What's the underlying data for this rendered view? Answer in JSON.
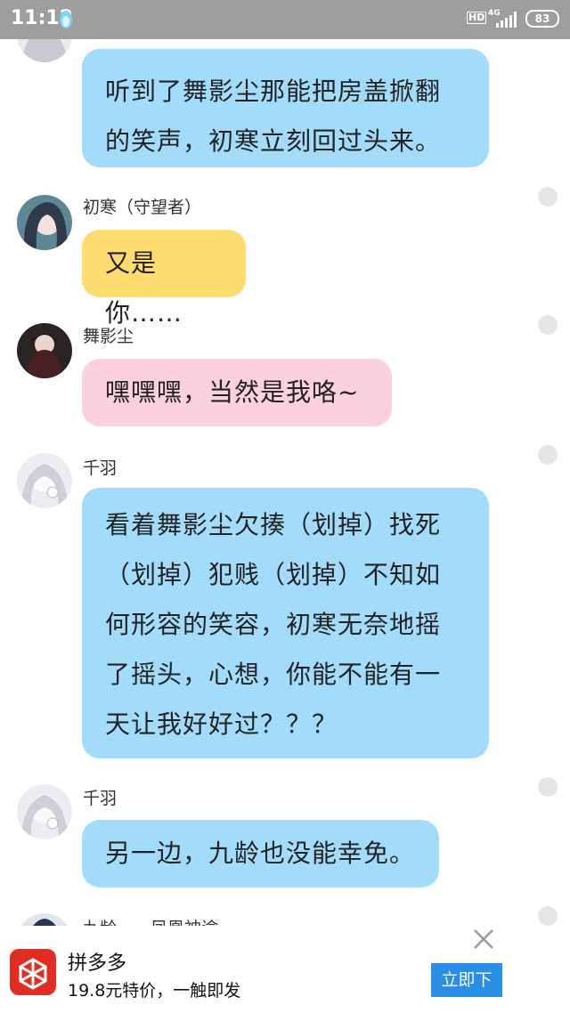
{
  "status_bar": {
    "time": "11:12",
    "hd_label": "HD",
    "network_label": "4G",
    "battery_level": "83",
    "app_icon": "qq-penguin-icon"
  },
  "messages": [
    {
      "sender": "",
      "color": "#a3dcfa",
      "text": "听到了舞影尘那能把房盖掀翻的笑声，初寒立刻回过头来。"
    },
    {
      "sender": "初寒（守望者）",
      "color": "#fedc70",
      "text": "又是你……"
    },
    {
      "sender": "舞影尘",
      "color": "#fcd1dd",
      "text": "嘿嘿嘿，当然是我咯~"
    },
    {
      "sender": "千羽",
      "color": "#a3dcfa",
      "text": "看着舞影尘欠揍（划掉）找死（划掉）犯贱（划掉）不知如何形容的笑容，初寒无奈地摇了摇头，心想，你能不能有一天让我好好过？？？"
    },
    {
      "sender": "千羽",
      "color": "#a3dcfa",
      "text": "另一边，九龄也没能幸免。"
    },
    {
      "sender": "九龄——凤凰神谕",
      "color": "#a3dcfa",
      "text": ""
    }
  ],
  "ad": {
    "title": "拼多多",
    "subtitle": "19.8元特价，一触即发",
    "button_label": "立即下",
    "close_icon": "close-icon",
    "logo_icon": "pinduoduo-logo-icon"
  }
}
